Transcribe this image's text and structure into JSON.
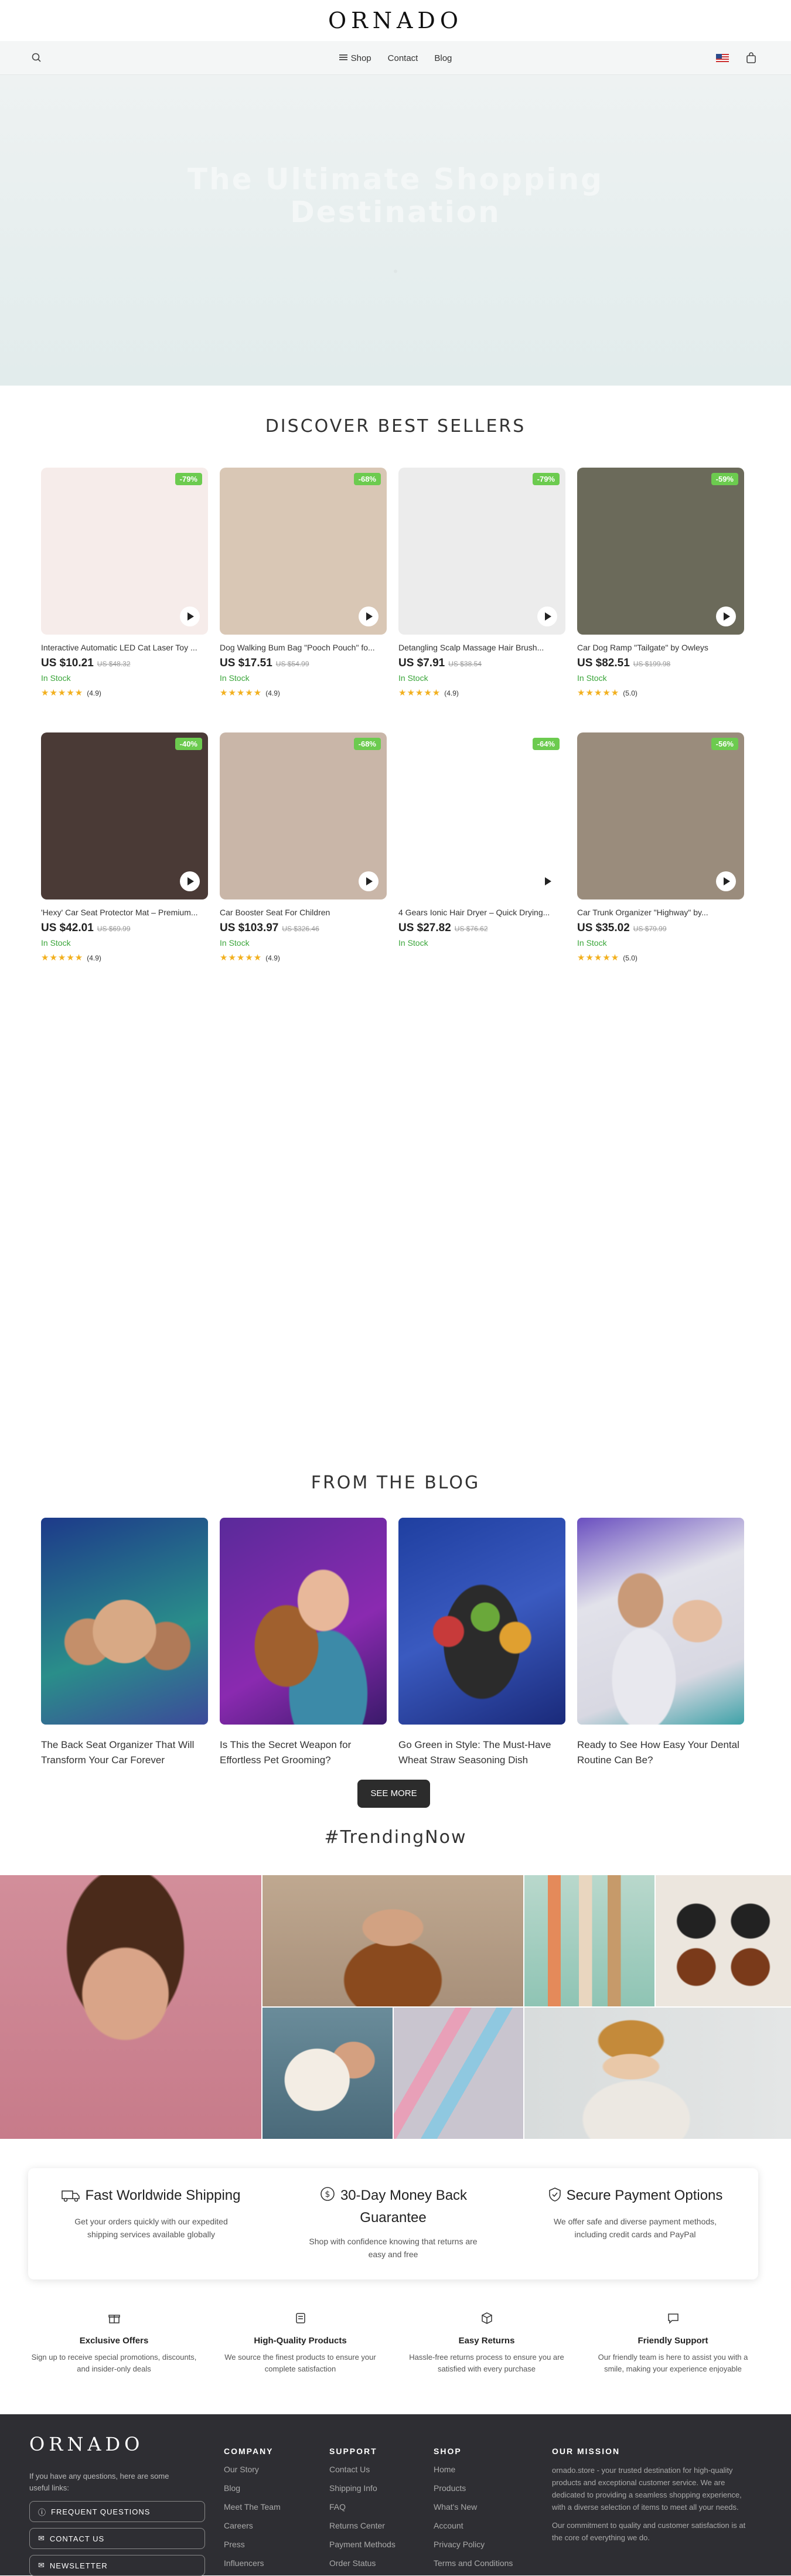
{
  "header": {
    "logo": "ORNADO",
    "nav": [
      "Shop",
      "Contact",
      "Blog"
    ]
  },
  "hero": {
    "headline_line1": "The Ultimate Shopping",
    "headline_line2": "Destination"
  },
  "bestsellers": {
    "title": "DISCOVER BEST SELLERS",
    "products": [
      {
        "title": "Interactive Automatic LED Cat Laser Toy ...",
        "price": "US $10.21",
        "old": "US $48.32",
        "discount": "-79%",
        "stock": "In Stock",
        "stars": "★★★★★",
        "rating": "(4.9)",
        "bg": "#f6ecea"
      },
      {
        "title": "Dog Walking Bum Bag \"Pooch Pouch\" fo...",
        "price": "US $17.51",
        "old": "US $54.99",
        "discount": "-68%",
        "stock": "In Stock",
        "stars": "★★★★★",
        "rating": "(4.9)",
        "bg": "#d9c7b5"
      },
      {
        "title": "Detangling Scalp Massage Hair Brush...",
        "price": "US $7.91",
        "old": "US $38.54",
        "discount": "-79%",
        "stock": "In Stock",
        "stars": "★★★★★",
        "rating": "(4.9)",
        "bg": "#ececec"
      },
      {
        "title": "Car Dog Ramp \"Tailgate\" by Owleys",
        "price": "US $82.51",
        "old": "US $199.98",
        "discount": "-59%",
        "stock": "In Stock",
        "stars": "★★★★★",
        "rating": "(5.0)",
        "bg": "#6b6a5a"
      },
      {
        "title": "'Hexy' Car Seat Protector Mat – Premium...",
        "price": "US $42.01",
        "old": "US $69.99",
        "discount": "-40%",
        "stock": "In Stock",
        "stars": "★★★★★",
        "rating": "(4.9)",
        "bg": "#4a3a36"
      },
      {
        "title": "Car Booster Seat For Children",
        "price": "US $103.97",
        "old": "US $326.46",
        "discount": "-68%",
        "stock": "In Stock",
        "stars": "★★★★★",
        "rating": "(4.9)",
        "bg": "#c9b6a8"
      },
      {
        "title": "4 Gears Ionic Hair Dryer – Quick Drying...",
        "price": "US $27.82",
        "old": "US $76.62",
        "discount": "-64%",
        "stock": "In Stock",
        "stars": "",
        "rating": "",
        "bg": "#ffffff"
      },
      {
        "title": "Car Trunk Organizer \"Highway\" by...",
        "price": "US $35.02",
        "old": "US $79.99",
        "discount": "-56%",
        "stock": "In Stock",
        "stars": "★★★★★",
        "rating": "(5.0)",
        "bg": "#9a8c7c"
      }
    ]
  },
  "blog": {
    "title": "FROM THE BLOG",
    "posts": [
      {
        "title": "The Back Seat Organizer That Will Transform Your Car Forever"
      },
      {
        "title": "Is This the Secret Weapon for Effortless Pet Grooming?"
      },
      {
        "title": "Go Green in Style: The Must-Have Wheat Straw Seasoning Dish"
      },
      {
        "title": "Ready to See How Easy Your Dental Routine Can Be?"
      }
    ],
    "see_more": "SEE MORE"
  },
  "trending": {
    "title": "#TrendingNow"
  },
  "features": [
    {
      "title": "Fast Worldwide Shipping",
      "text": "Get your orders quickly with our expedited shipping services available globally"
    },
    {
      "title": "30-Day Money Back Guarantee",
      "text": "Shop with confidence knowing that returns are easy and free"
    },
    {
      "title": "Secure Payment Options",
      "text": "We offer safe and diverse payment methods, including credit cards and PayPal"
    }
  ],
  "why": [
    {
      "title": "Exclusive Offers",
      "text": "Sign up to receive special promotions, discounts, and insider-only deals"
    },
    {
      "title": "High-Quality Products",
      "text": "We source the finest products to ensure your complete satisfaction"
    },
    {
      "title": "Easy Returns",
      "text": "Hassle-free returns process to ensure you are satisfied with every purchase"
    },
    {
      "title": "Friendly Support",
      "text": "Our friendly team is here to assist you with a smile, making your experience enjoyable"
    }
  ],
  "footer": {
    "logo": "ORNADO",
    "intro": "If you have any questions, here are some useful links:",
    "buttons": [
      "FREQUENT QUESTIONS",
      "CONTACT US",
      "NEWSLETTER"
    ],
    "company": {
      "title": "COMPANY",
      "links": [
        "Our Story",
        "Blog",
        "Meet The Team",
        "Careers",
        "Press",
        "Influencers"
      ]
    },
    "support": {
      "title": "SUPPORT",
      "links": [
        "Contact Us",
        "Shipping Info",
        "FAQ",
        "Returns Center",
        "Payment Methods",
        "Order Status"
      ]
    },
    "shop": {
      "title": "SHOP",
      "links": [
        "Home",
        "Products",
        "What's New",
        "Account",
        "Privacy Policy",
        "Terms and Conditions"
      ]
    },
    "mission": {
      "title": "OUR MISSION",
      "p1": "ornado.store - your trusted destination for high-quality products and exceptional customer service. We are dedicated to providing a seamless shopping experience, with a diverse selection of items to meet all your needs.",
      "p2": "Our commitment to quality and customer satisfaction is at the core of everything we do."
    }
  },
  "colors": {
    "accent_green": "#6ccb4f",
    "stock_green": "#3aa53a",
    "star": "#f2b01e",
    "footer_bg": "#2e2e33"
  }
}
